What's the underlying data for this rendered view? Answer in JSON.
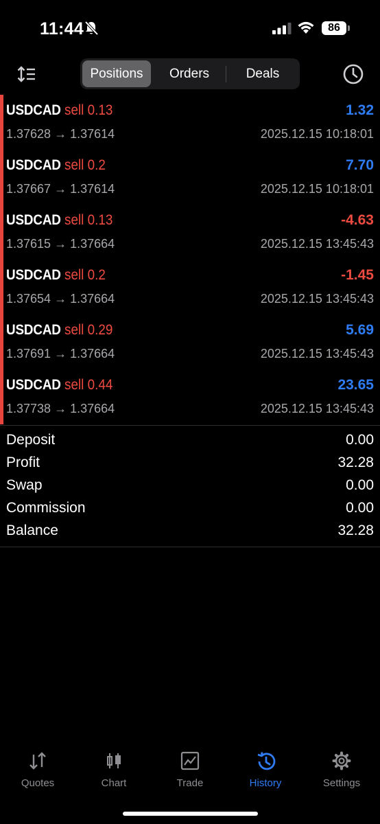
{
  "status_bar": {
    "time": "11:44",
    "battery": "86"
  },
  "tabs": [
    {
      "label": "Positions",
      "active": true
    },
    {
      "label": "Orders",
      "active": false
    },
    {
      "label": "Deals",
      "active": false
    }
  ],
  "colors": {
    "profit": "#2e7cf6",
    "loss": "#ee4b40",
    "sell": "#ee4b40",
    "accent": "#e8453c"
  },
  "positions": [
    {
      "symbol": "USDCAD",
      "side": "sell 0.13",
      "profit": "1.32",
      "prices": "1.37628 → 1.37614",
      "time": "2025.12.15 10:18:01",
      "positive": true
    },
    {
      "symbol": "USDCAD",
      "side": "sell 0.2",
      "profit": "7.70",
      "prices": "1.37667 → 1.37614",
      "time": "2025.12.15 10:18:01",
      "positive": true
    },
    {
      "symbol": "USDCAD",
      "side": "sell 0.13",
      "profit": "-4.63",
      "prices": "1.37615 → 1.37664",
      "time": "2025.12.15 13:45:43",
      "positive": false
    },
    {
      "symbol": "USDCAD",
      "side": "sell 0.2",
      "profit": "-1.45",
      "prices": "1.37654 → 1.37664",
      "time": "2025.12.15 13:45:43",
      "positive": false
    },
    {
      "symbol": "USDCAD",
      "side": "sell 0.29",
      "profit": "5.69",
      "prices": "1.37691 → 1.37664",
      "time": "2025.12.15 13:45:43",
      "positive": true
    },
    {
      "symbol": "USDCAD",
      "side": "sell 0.44",
      "profit": "23.65",
      "prices": "1.37738 → 1.37664",
      "time": "2025.12.15 13:45:43",
      "positive": true
    }
  ],
  "summary": [
    {
      "label": "Deposit",
      "value": "0.00"
    },
    {
      "label": "Profit",
      "value": "32.28"
    },
    {
      "label": "Swap",
      "value": "0.00"
    },
    {
      "label": "Commission",
      "value": "0.00"
    },
    {
      "label": "Balance",
      "value": "32.28"
    }
  ],
  "tabbar": [
    {
      "label": "Quotes",
      "icon": "quotes-arrows-icon",
      "active": false
    },
    {
      "label": "Chart",
      "icon": "candlestick-chart-icon",
      "active": false
    },
    {
      "label": "Trade",
      "icon": "trade-chart-icon",
      "active": false
    },
    {
      "label": "History",
      "icon": "history-icon",
      "active": true
    },
    {
      "label": "Settings",
      "icon": "gear-icon",
      "active": false
    }
  ]
}
